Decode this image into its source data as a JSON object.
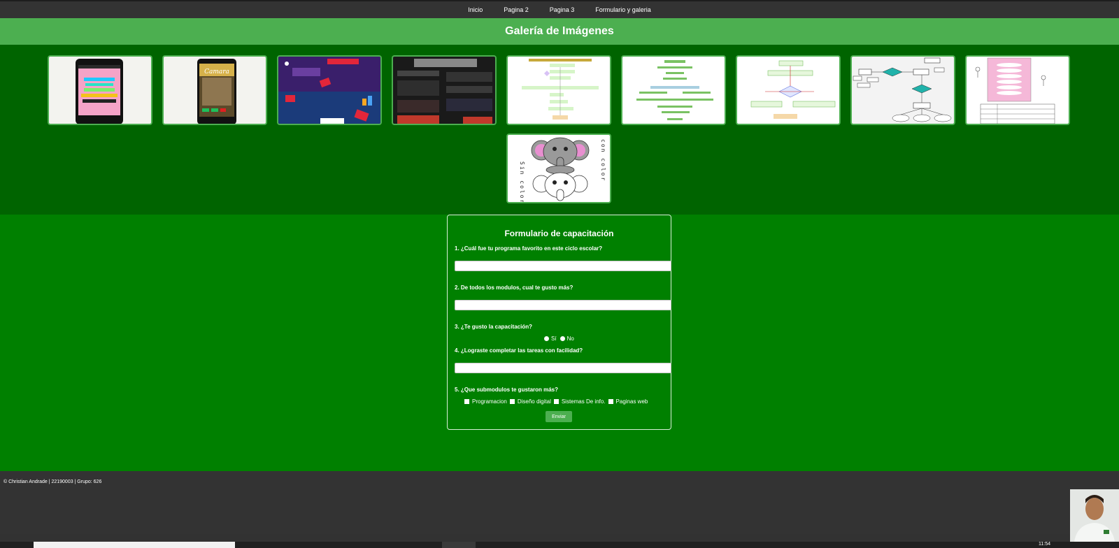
{
  "nav": {
    "items": [
      "Inicio",
      "Pagina 2",
      "Pagina 3",
      "Formulario y galeria"
    ]
  },
  "banner": {
    "title": "Galería de Imágenes"
  },
  "gallery": {
    "images": [
      {
        "name": "phone-app-menu-image",
        "labels": []
      },
      {
        "name": "phone-camera-app-image",
        "labels": [
          "Camara"
        ]
      },
      {
        "name": "youtube-infographic-image",
        "labels": []
      },
      {
        "name": "dark-infographic-image",
        "labels": []
      },
      {
        "name": "flowchart-image-1",
        "labels": []
      },
      {
        "name": "flowchart-image-2",
        "labels": []
      },
      {
        "name": "flowchart-image-3",
        "labels": []
      },
      {
        "name": "entity-relationship-diagram-image",
        "labels": []
      },
      {
        "name": "use-case-diagram-image",
        "labels": []
      },
      {
        "name": "elephant-coloring-image",
        "labels": [
          "con color",
          "Sin color"
        ]
      }
    ]
  },
  "form": {
    "title": "Formulario de capacitación",
    "q1": "1. ¿Cuál fue tu programa favorito en este ciclo escolar?",
    "q2": "2. De todos los modulos, cual te gusto más?",
    "q3": "3. ¿Te gusto la capacitación?",
    "q3_options": [
      "Sí",
      "No"
    ],
    "q4": "4. ¿Lograste completar las tareas con facilidad?",
    "q5": "5. ¿Que submodulos te gustaron más?",
    "q5_options": [
      "Programacion",
      "Diseño digital",
      "Sistemas De info.",
      "Paginas web"
    ],
    "submit_label": "Enviar"
  },
  "footer": {
    "credit": "© Christian Andrade | 22190003 | Grupo: 626"
  },
  "taskbar": {
    "clock": "11:54"
  },
  "colors": {
    "nav_bg": "#333333",
    "banner_bg": "#4caf50",
    "gallery_bg": "#006400",
    "form_bg": "#008000",
    "footer_bg": "#333333",
    "button_bg": "#4caf50"
  }
}
